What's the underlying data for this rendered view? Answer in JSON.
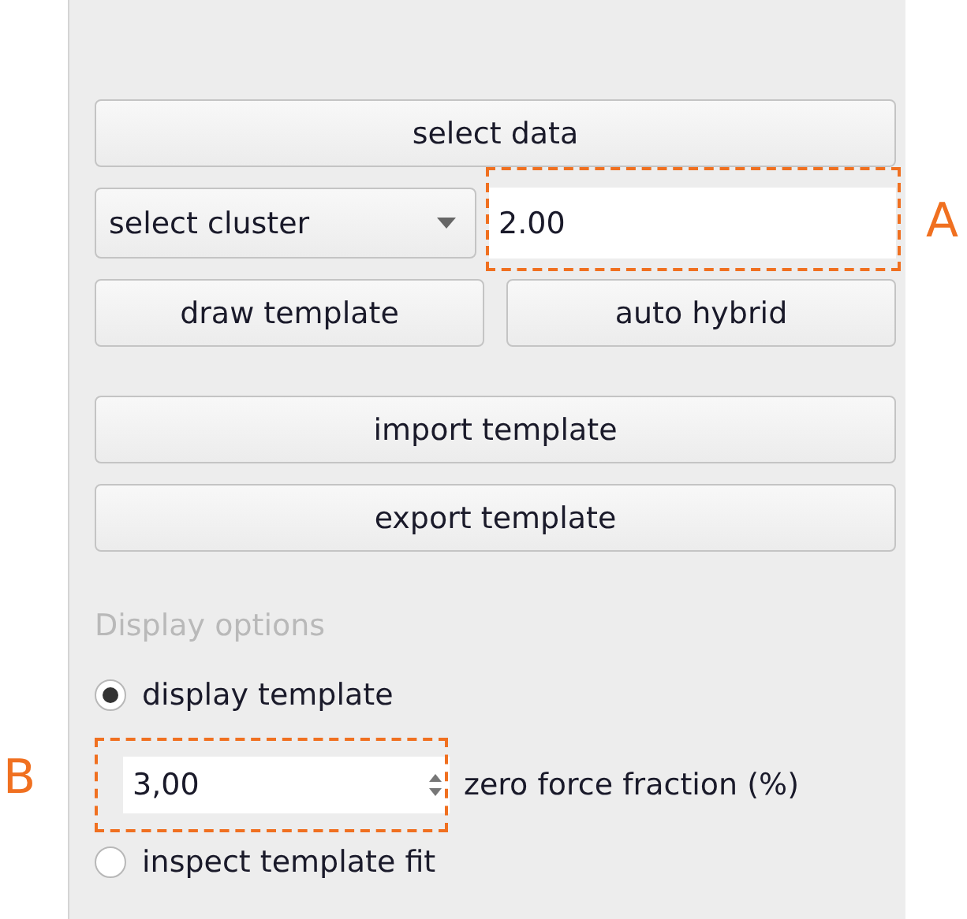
{
  "select_data_button": "select data",
  "cluster_dropdown": {
    "value": "select cluster"
  },
  "threshold_field": {
    "value": "2.00"
  },
  "template_buttons": [
    "draw template",
    "auto hybrid"
  ],
  "file_buttons": [
    "import template",
    "export template"
  ],
  "display_options": {
    "title": "Display options",
    "display_template": {
      "label": "display template",
      "selected": true
    },
    "zero_force_fraction": {
      "value": "3,00",
      "label": "zero force fraction (%)"
    },
    "inspect_fit": {
      "label": "inspect template fit",
      "selected": false
    }
  },
  "annotations": [
    {
      "label": "A"
    },
    {
      "label": "B"
    }
  ]
}
